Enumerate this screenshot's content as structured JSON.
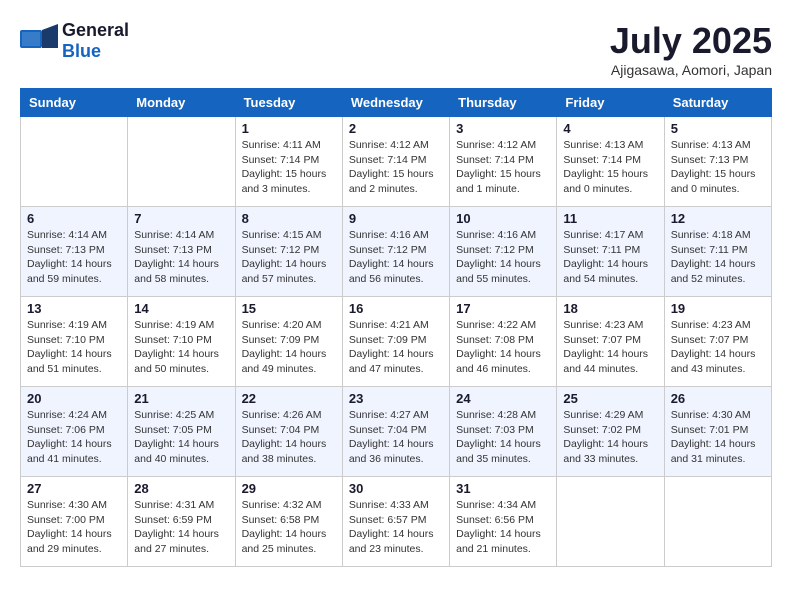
{
  "header": {
    "logo": {
      "general": "General",
      "blue": "Blue"
    },
    "title": "July 2025",
    "subtitle": "Ajigasawa, Aomori, Japan"
  },
  "calendar": {
    "weekdays": [
      "Sunday",
      "Monday",
      "Tuesday",
      "Wednesday",
      "Thursday",
      "Friday",
      "Saturday"
    ],
    "weeks": [
      [
        {
          "day": "",
          "info": ""
        },
        {
          "day": "",
          "info": ""
        },
        {
          "day": "1",
          "info": "Sunrise: 4:11 AM\nSunset: 7:14 PM\nDaylight: 15 hours\nand 3 minutes."
        },
        {
          "day": "2",
          "info": "Sunrise: 4:12 AM\nSunset: 7:14 PM\nDaylight: 15 hours\nand 2 minutes."
        },
        {
          "day": "3",
          "info": "Sunrise: 4:12 AM\nSunset: 7:14 PM\nDaylight: 15 hours\nand 1 minute."
        },
        {
          "day": "4",
          "info": "Sunrise: 4:13 AM\nSunset: 7:14 PM\nDaylight: 15 hours\nand 0 minutes."
        },
        {
          "day": "5",
          "info": "Sunrise: 4:13 AM\nSunset: 7:13 PM\nDaylight: 15 hours\nand 0 minutes."
        }
      ],
      [
        {
          "day": "6",
          "info": "Sunrise: 4:14 AM\nSunset: 7:13 PM\nDaylight: 14 hours\nand 59 minutes."
        },
        {
          "day": "7",
          "info": "Sunrise: 4:14 AM\nSunset: 7:13 PM\nDaylight: 14 hours\nand 58 minutes."
        },
        {
          "day": "8",
          "info": "Sunrise: 4:15 AM\nSunset: 7:12 PM\nDaylight: 14 hours\nand 57 minutes."
        },
        {
          "day": "9",
          "info": "Sunrise: 4:16 AM\nSunset: 7:12 PM\nDaylight: 14 hours\nand 56 minutes."
        },
        {
          "day": "10",
          "info": "Sunrise: 4:16 AM\nSunset: 7:12 PM\nDaylight: 14 hours\nand 55 minutes."
        },
        {
          "day": "11",
          "info": "Sunrise: 4:17 AM\nSunset: 7:11 PM\nDaylight: 14 hours\nand 54 minutes."
        },
        {
          "day": "12",
          "info": "Sunrise: 4:18 AM\nSunset: 7:11 PM\nDaylight: 14 hours\nand 52 minutes."
        }
      ],
      [
        {
          "day": "13",
          "info": "Sunrise: 4:19 AM\nSunset: 7:10 PM\nDaylight: 14 hours\nand 51 minutes."
        },
        {
          "day": "14",
          "info": "Sunrise: 4:19 AM\nSunset: 7:10 PM\nDaylight: 14 hours\nand 50 minutes."
        },
        {
          "day": "15",
          "info": "Sunrise: 4:20 AM\nSunset: 7:09 PM\nDaylight: 14 hours\nand 49 minutes."
        },
        {
          "day": "16",
          "info": "Sunrise: 4:21 AM\nSunset: 7:09 PM\nDaylight: 14 hours\nand 47 minutes."
        },
        {
          "day": "17",
          "info": "Sunrise: 4:22 AM\nSunset: 7:08 PM\nDaylight: 14 hours\nand 46 minutes."
        },
        {
          "day": "18",
          "info": "Sunrise: 4:23 AM\nSunset: 7:07 PM\nDaylight: 14 hours\nand 44 minutes."
        },
        {
          "day": "19",
          "info": "Sunrise: 4:23 AM\nSunset: 7:07 PM\nDaylight: 14 hours\nand 43 minutes."
        }
      ],
      [
        {
          "day": "20",
          "info": "Sunrise: 4:24 AM\nSunset: 7:06 PM\nDaylight: 14 hours\nand 41 minutes."
        },
        {
          "day": "21",
          "info": "Sunrise: 4:25 AM\nSunset: 7:05 PM\nDaylight: 14 hours\nand 40 minutes."
        },
        {
          "day": "22",
          "info": "Sunrise: 4:26 AM\nSunset: 7:04 PM\nDaylight: 14 hours\nand 38 minutes."
        },
        {
          "day": "23",
          "info": "Sunrise: 4:27 AM\nSunset: 7:04 PM\nDaylight: 14 hours\nand 36 minutes."
        },
        {
          "day": "24",
          "info": "Sunrise: 4:28 AM\nSunset: 7:03 PM\nDaylight: 14 hours\nand 35 minutes."
        },
        {
          "day": "25",
          "info": "Sunrise: 4:29 AM\nSunset: 7:02 PM\nDaylight: 14 hours\nand 33 minutes."
        },
        {
          "day": "26",
          "info": "Sunrise: 4:30 AM\nSunset: 7:01 PM\nDaylight: 14 hours\nand 31 minutes."
        }
      ],
      [
        {
          "day": "27",
          "info": "Sunrise: 4:30 AM\nSunset: 7:00 PM\nDaylight: 14 hours\nand 29 minutes."
        },
        {
          "day": "28",
          "info": "Sunrise: 4:31 AM\nSunset: 6:59 PM\nDaylight: 14 hours\nand 27 minutes."
        },
        {
          "day": "29",
          "info": "Sunrise: 4:32 AM\nSunset: 6:58 PM\nDaylight: 14 hours\nand 25 minutes."
        },
        {
          "day": "30",
          "info": "Sunrise: 4:33 AM\nSunset: 6:57 PM\nDaylight: 14 hours\nand 23 minutes."
        },
        {
          "day": "31",
          "info": "Sunrise: 4:34 AM\nSunset: 6:56 PM\nDaylight: 14 hours\nand 21 minutes."
        },
        {
          "day": "",
          "info": ""
        },
        {
          "day": "",
          "info": ""
        }
      ]
    ]
  }
}
